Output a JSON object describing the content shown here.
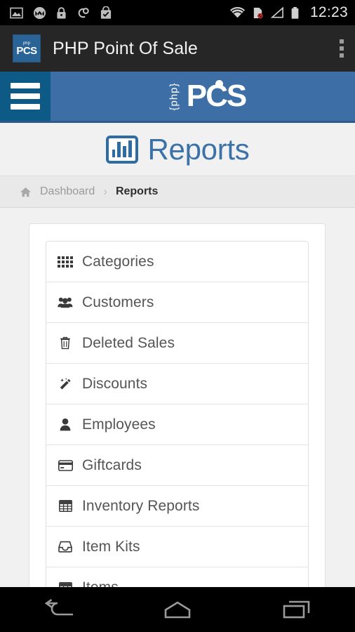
{
  "status_bar": {
    "time": "12:23",
    "left_icons": [
      {
        "name": "image-icon",
        "label": "Screenshot"
      },
      {
        "name": "motorola-icon",
        "label": "Motorola"
      },
      {
        "name": "lock-icon",
        "label": "Lock"
      },
      {
        "name": "sync-link-icon",
        "label": "Link"
      },
      {
        "name": "shopping-bag-check-icon",
        "label": "Play Store"
      }
    ],
    "right_icons": [
      {
        "name": "wifi-icon",
        "label": "Wi-Fi"
      },
      {
        "name": "no-sim-icon",
        "label": "No SIM"
      },
      {
        "name": "signal-icon",
        "label": "Signal"
      },
      {
        "name": "battery-icon",
        "label": "Battery"
      }
    ]
  },
  "action_bar": {
    "app_icon_top": "php",
    "app_icon_text": "PCS",
    "title": "PHP Point Of Sale",
    "overflow_label": "More options"
  },
  "navbar": {
    "menu_label": "Menu",
    "brand_php": "{php}",
    "brand_pcs": "PCS"
  },
  "page": {
    "title": "Reports",
    "title_icon": "bar-chart-icon"
  },
  "breadcrumb": {
    "home_icon": "home-icon",
    "parent": "Dashboard",
    "separator": "›",
    "current": "Reports"
  },
  "reports_list": [
    {
      "label": "Categories",
      "icon": "grid-icon"
    },
    {
      "label": "Customers",
      "icon": "users-icon"
    },
    {
      "label": "Deleted Sales",
      "icon": "trash-icon"
    },
    {
      "label": "Discounts",
      "icon": "magic-wand-icon"
    },
    {
      "label": "Employees",
      "icon": "user-icon"
    },
    {
      "label": "Giftcards",
      "icon": "credit-card-icon"
    },
    {
      "label": "Inventory Reports",
      "icon": "table-icon"
    },
    {
      "label": "Item Kits",
      "icon": "inbox-icon"
    },
    {
      "label": "Items",
      "icon": "table-icon"
    }
  ],
  "system_nav": {
    "back": "Back",
    "home": "Home",
    "recents": "Recent apps"
  },
  "colors": {
    "brand_blue": "#3d6ea5",
    "brand_dark_blue": "#0e5a86",
    "title_blue": "#2e6da4",
    "page_bg": "#f1f1f1",
    "action_bar": "#262626"
  }
}
